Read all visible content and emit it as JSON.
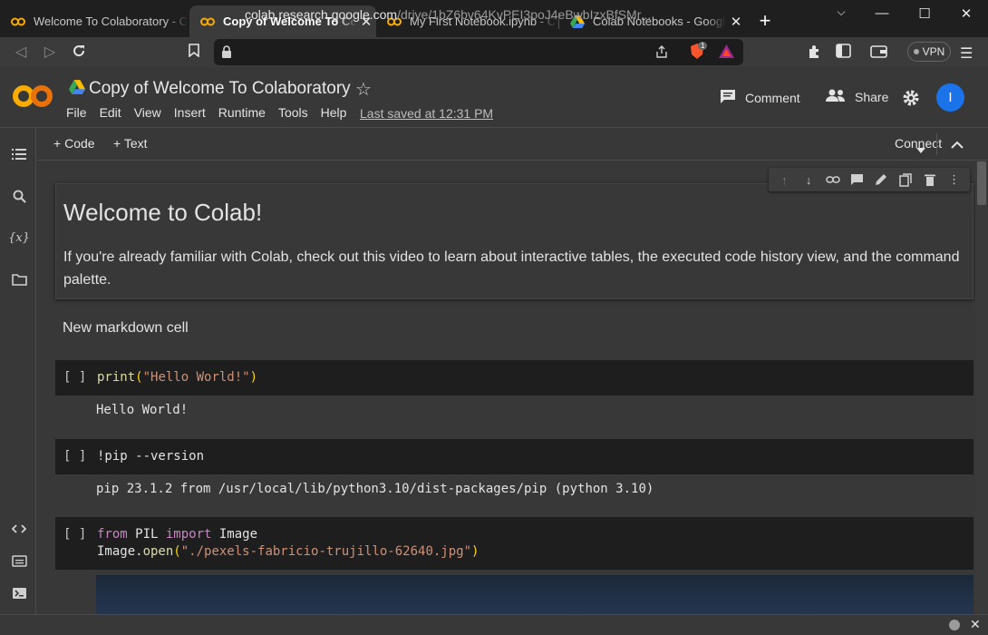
{
  "browser": {
    "tabs": [
      {
        "title": "Welcome To Colaboratory - Colab",
        "icon": "colab-logo-icon",
        "active": false
      },
      {
        "title": "Copy of Welcome To Colab",
        "icon": "colab-logo-icon",
        "active": true
      },
      {
        "title": "My First Notebook.ipynb - Colab",
        "icon": "colab-logo-icon",
        "active": false
      },
      {
        "title": "Colab Notebooks - Google Drive",
        "icon": "google-drive-icon",
        "active": false
      }
    ],
    "url_host": "colab.research.google.com",
    "url_path": "/drive/1bZ6bv64KvPEI3poJ4eBwbIzxBfSMr...",
    "vpn_label": "VPN",
    "brave_badge": "1"
  },
  "colab": {
    "notebook_title": "Copy of Welcome To Colaboratory",
    "menu": [
      "File",
      "Edit",
      "View",
      "Insert",
      "Runtime",
      "Tools",
      "Help"
    ],
    "last_saved": "Last saved at 12:31 PM",
    "comment_label": "Comment",
    "share_label": "Share",
    "avatar_letter": "I",
    "add_code_label": "Code",
    "add_text_label": "Text",
    "connect_label": "Connect"
  },
  "cells": {
    "welcome_heading": "Welcome to Colab!",
    "welcome_body": "If you're already familiar with Colab, check out this video to learn about interactive tables, the executed code history view, and the command palette.",
    "markdown2": "New markdown cell",
    "run_indicator": "[ ]",
    "code1_output": "Hello World!",
    "code2_source": "!pip --version",
    "code2_output": "pip 23.1.2 from /usr/local/lib/python3.10/dist-packages/pip (python 3.10)",
    "code1_tokens": {
      "fn": "print",
      "open": "(",
      "str": "\"Hello World!\"",
      "close": ")"
    },
    "code3_tokens": {
      "kw1": "from",
      "mod": " PIL ",
      "kw2": "import",
      "name": " Image",
      "line2_obj": "Image.",
      "line2_fn": "open",
      "open": "(",
      "str": "\"./pexels-fabricio-trujillo-62640.jpg\"",
      "close": ")"
    }
  },
  "colors": {
    "accent": "#1a73e8",
    "colab_orange": "#f9ab00",
    "string": "#ce9178",
    "keyword": "#c586c0",
    "function": "#dcdcaa"
  }
}
